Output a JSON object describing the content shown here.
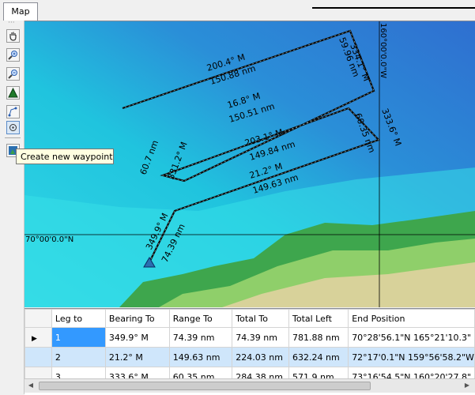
{
  "tab": {
    "label": "Map"
  },
  "tooltip": {
    "text": "Create new waypoint"
  },
  "map": {
    "lat_label": "70°00'0.0\"N",
    "lon_label": "160°00'0.0\"W",
    "legs": [
      {
        "bearing": "200.4° M",
        "range": "150.88 nm"
      },
      {
        "bearing": "334.1° M",
        "range": "59.96 nm"
      },
      {
        "bearing": "16.8° M",
        "range": "150.51 nm"
      },
      {
        "bearing": "333.6° M",
        "range": "60.35 nm"
      },
      {
        "bearing": "203.1° M",
        "range": "149.84 nm"
      },
      {
        "bearing": "331.2° M",
        "range": "60.7 nm"
      },
      {
        "bearing": "21.2° M",
        "range": "149.63 nm"
      },
      {
        "bearing": "349.9° M",
        "range": "74.39 nm"
      }
    ]
  },
  "grid": {
    "columns": [
      "Leg to",
      "Bearing To",
      "Range To",
      "Total To",
      "Total Left",
      "End Position"
    ],
    "rows": [
      [
        "1",
        "349.9° M",
        "74.39 nm",
        "74.39 nm",
        "781.88 nm",
        "70°28'56.1\"N 165°21'10.3\""
      ],
      [
        "2",
        "21.2° M",
        "149.63 nm",
        "224.03 nm",
        "632.24 nm",
        "72°17'0.1\"N 159°56'58.2\"W"
      ],
      [
        "3",
        "333.6° M",
        "60.35 nm",
        "284.38 nm",
        "571.9 nm",
        "73°16'54.5\"N 160°20'27.8\""
      ]
    ]
  },
  "toolbar": [
    {
      "name": "pan-hand-icon"
    },
    {
      "name": "zoom-in-icon"
    },
    {
      "name": "zoom-out-icon"
    },
    {
      "name": "waypoint-marker-icon"
    },
    {
      "name": "route-icon"
    },
    {
      "name": "circle-target-icon"
    },
    {
      "name": "create-waypoint-icon"
    }
  ]
}
